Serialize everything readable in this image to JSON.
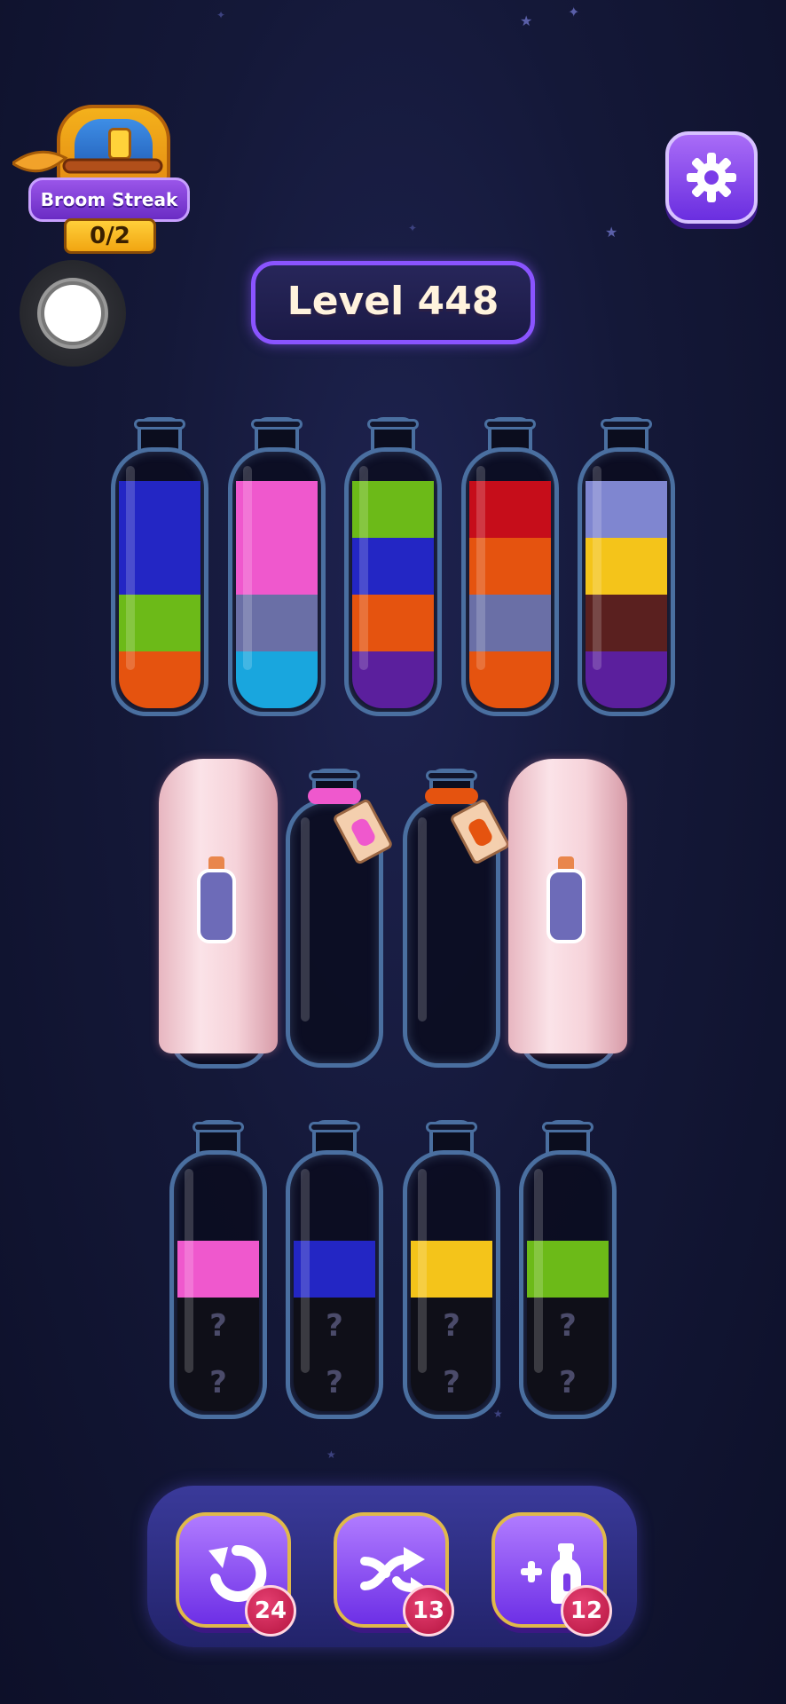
{
  "streak": {
    "title": "Broom Streak",
    "count": "0/2"
  },
  "level": {
    "label": "Level 448"
  },
  "colors": {
    "blue": "#2326c4",
    "green": "#6cba18",
    "orange": "#e5530f",
    "pink": "#ef58cd",
    "slate": "#6a6fa6",
    "cyan": "#19a6de",
    "purple": "#5b1f9d",
    "red": "#c60d1a",
    "lavender": "#7f86d0",
    "yellow": "#f4c41a",
    "brown": "#5a201f"
  },
  "bottles_top": [
    {
      "segments_bottom_to_top": [
        "orange",
        "green",
        "blue",
        "blue"
      ]
    },
    {
      "segments_bottom_to_top": [
        "cyan",
        "slate",
        "pink",
        "pink"
      ]
    },
    {
      "segments_bottom_to_top": [
        "purple",
        "orange",
        "blue",
        "green"
      ]
    },
    {
      "segments_bottom_to_top": [
        "orange",
        "slate",
        "orange",
        "red"
      ]
    },
    {
      "segments_bottom_to_top": [
        "purple",
        "brown",
        "yellow",
        "lavender"
      ]
    }
  ],
  "bottles_middle": [
    {
      "state": "covered"
    },
    {
      "state": "locked",
      "tag_color": "pink"
    },
    {
      "state": "locked",
      "tag_color": "orange"
    },
    {
      "state": "covered"
    }
  ],
  "bottles_bottom": [
    {
      "top_color": "pink",
      "hidden": [
        "?",
        "?"
      ]
    },
    {
      "top_color": "blue",
      "hidden": [
        "?",
        "?"
      ]
    },
    {
      "top_color": "yellow",
      "hidden": [
        "?",
        "?"
      ]
    },
    {
      "top_color": "green",
      "hidden": [
        "?",
        "?"
      ]
    }
  ],
  "toolbar": {
    "undo": {
      "icon": "undo-icon",
      "count": "24"
    },
    "shuffle": {
      "icon": "shuffle-icon",
      "count": "13"
    },
    "add_bottle": {
      "icon": "add-bottle-icon",
      "count": "12"
    }
  }
}
